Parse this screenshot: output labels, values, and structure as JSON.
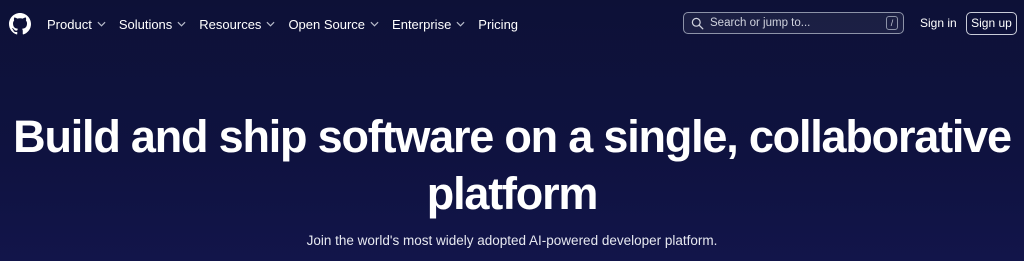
{
  "header": {
    "logo_icon": "github-octocat-icon",
    "nav": [
      {
        "label": "Product",
        "has_dropdown": true
      },
      {
        "label": "Solutions",
        "has_dropdown": true
      },
      {
        "label": "Resources",
        "has_dropdown": true
      },
      {
        "label": "Open Source",
        "has_dropdown": true
      },
      {
        "label": "Enterprise",
        "has_dropdown": true
      },
      {
        "label": "Pricing",
        "has_dropdown": false
      }
    ],
    "search": {
      "placeholder": "Search or jump to...",
      "shortcut": "/"
    },
    "signin_label": "Sign in",
    "signup_label": "Sign up"
  },
  "hero": {
    "title": "Build and ship software on a single, collaborative platform",
    "subtitle": "Join the world's most widely adopted AI-powered developer platform."
  },
  "colors": {
    "background": "#0f1240",
    "text": "#ffffff",
    "border": "#8d93a8"
  }
}
